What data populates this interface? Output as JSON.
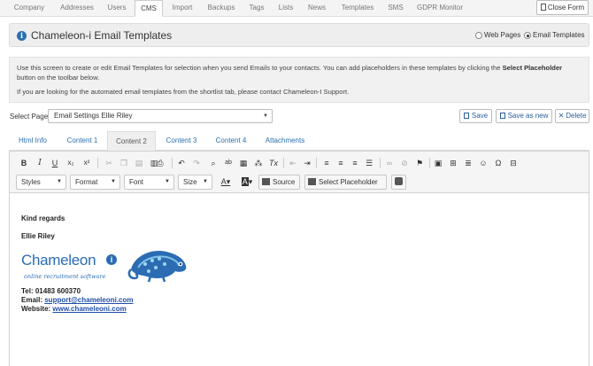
{
  "topnav": {
    "tabs": [
      "Company",
      "Addresses",
      "Users",
      "CMS",
      "Import",
      "Backups",
      "Tags",
      "Lists",
      "News",
      "Templates",
      "SMS",
      "GDPR Monitor"
    ],
    "active": "CMS",
    "close_label": "Close Form"
  },
  "header": {
    "title": "Chameleon-i Email Templates",
    "radio_web": "Web Pages",
    "radio_email": "Email Templates",
    "selected": "Email Templates"
  },
  "description": {
    "line1_a": "Use this screen to create or edit Email Templates for selection when you send Emails to your contacts. You can add placeholders in these templates by clicking the ",
    "line1_bold": "Select Placeholder",
    "line1_b": " button on the toolbar below.",
    "line2": "If you are looking for the automated email templates from the shortlist tab, please contact Chameleon-I Support."
  },
  "select_page": {
    "label": "Select Page",
    "value": "Email Settings Ellie Riley"
  },
  "actions": {
    "save": "Save",
    "save_as_new": "Save as new",
    "delete": "Delete"
  },
  "content_tabs": [
    "Html Info",
    "Content 1",
    "Content 2",
    "Content 3",
    "Content 4",
    "Attachments"
  ],
  "active_content_tab": "Content 2",
  "toolbar": {
    "styles": "Styles",
    "format": "Format",
    "font": "Font",
    "size": "Size",
    "source": "Source",
    "select_placeholder": "Select Placeholder"
  },
  "email_body": {
    "regards": "Kind regards",
    "name": "Ellie Riley",
    "logo_text": "Chameleon",
    "logo_tagline": "online recruitment software",
    "tel": "Tel: 01483 600370",
    "email_label": "Email: ",
    "email_value": "support@chameleoni.com",
    "website_label": "Website: ",
    "website_value": "www.chameleoni.com"
  },
  "colors": {
    "brand_blue": "#2b6cb3",
    "link_blue": "#1f4ea8"
  }
}
